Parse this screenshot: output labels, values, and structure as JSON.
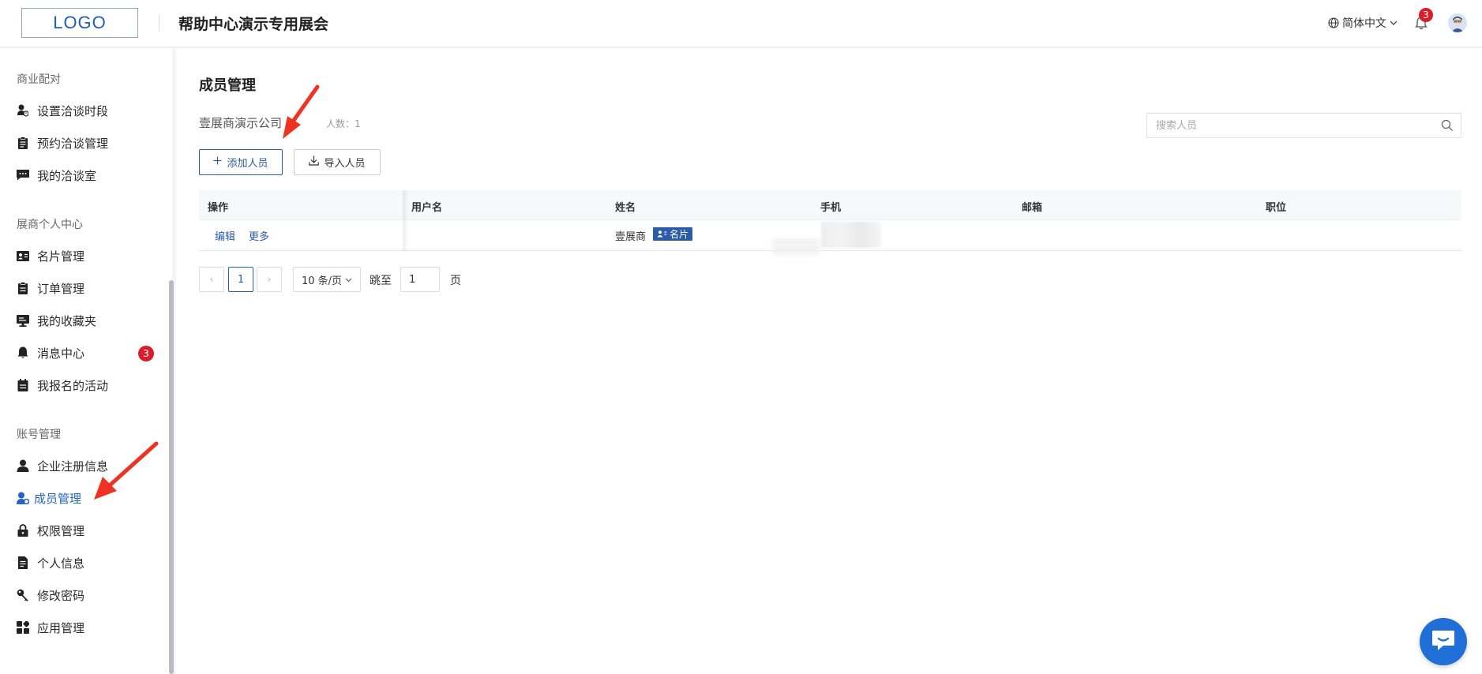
{
  "header": {
    "logo_text": "LOGO",
    "site_title": "帮助中心演示专用展会",
    "language": "简体中文",
    "notification_count": "3"
  },
  "sidebar": {
    "groups": [
      {
        "title": "商业配对",
        "items": [
          {
            "label": "设置洽谈时段",
            "icon": "user-clock-icon"
          },
          {
            "label": "预约洽谈管理",
            "icon": "clipboard-icon"
          },
          {
            "label": "我的洽谈室",
            "icon": "chat-icon"
          }
        ]
      },
      {
        "title": "展商个人中心",
        "items": [
          {
            "label": "名片管理",
            "icon": "id-card-icon"
          },
          {
            "label": "订单管理",
            "icon": "clipboard-icon"
          },
          {
            "label": "我的收藏夹",
            "icon": "monitor-icon"
          },
          {
            "label": "消息中心",
            "icon": "bell-icon",
            "badge": "3"
          },
          {
            "label": "我报名的活动",
            "icon": "calendar-icon"
          }
        ]
      },
      {
        "title": "账号管理",
        "items": [
          {
            "label": "企业注册信息",
            "icon": "user-icon"
          },
          {
            "label": "成员管理",
            "icon": "user-gear-icon",
            "active": true
          },
          {
            "label": "权限管理",
            "icon": "lock-icon"
          },
          {
            "label": "个人信息",
            "icon": "document-icon"
          },
          {
            "label": "修改密码",
            "icon": "key-icon"
          },
          {
            "label": "应用管理",
            "icon": "apps-icon"
          }
        ]
      }
    ]
  },
  "main": {
    "title": "成员管理",
    "company_name": "壹展商演示公司",
    "member_count_label": "人数：1",
    "search_placeholder": "搜索人员",
    "add_button": "添加人员",
    "import_button": "导入人员",
    "table": {
      "columns": [
        "操作",
        "用户名",
        "姓名",
        "手机",
        "邮箱",
        "职位"
      ],
      "rows": [
        {
          "actions": [
            "编辑",
            "更多"
          ],
          "username": "",
          "name": "壹展商",
          "tag": "名片",
          "phone": "",
          "email": "",
          "position": ""
        }
      ]
    },
    "pagination": {
      "prev": "‹",
      "current_page": "1",
      "next": "›",
      "page_size": "10 条/页",
      "goto_label": "跳至",
      "goto_value": "1",
      "page_suffix": "页"
    }
  },
  "colors": {
    "accent": "#2a5caa",
    "badge": "#d81e2a",
    "arrow": "#ee3322",
    "chat": "#1f6fd6"
  }
}
